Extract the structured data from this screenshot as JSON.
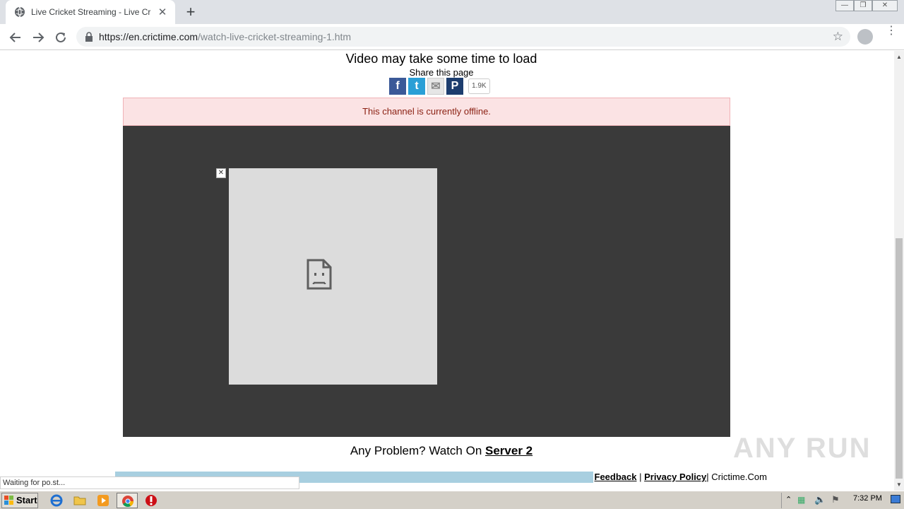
{
  "browser": {
    "tab_title": "Live Cricket Streaming - Live Cricket",
    "tab_close": "✕",
    "new_tab": "+",
    "url_domain": "https://en.crictime.com",
    "url_path": "/watch-live-cricket-streaming-1.htm",
    "win_minimize": "—",
    "win_restore": "❐",
    "win_close": "✕"
  },
  "page": {
    "heading": "Video may take some time to load",
    "share_label": "Share this page",
    "share_buttons": [
      {
        "name": "facebook",
        "glyph": "f",
        "color": "#3b5998"
      },
      {
        "name": "twitter",
        "glyph": "t",
        "color": "#2a9fd6"
      },
      {
        "name": "email",
        "glyph": "✉",
        "color": "#e6e6e6"
      },
      {
        "name": "pinterest",
        "glyph": "P",
        "color": "#1d3d6e"
      }
    ],
    "share_count": "1.9K",
    "offline_message": "This channel is currently offline.",
    "ad_close": "✕",
    "problem_text": "Any Problem? Watch On ",
    "server_link": "Server 2",
    "footer": {
      "feedback": "Feedback",
      "separator1": " | ",
      "privacy": "Privacy Policy",
      "separator2": "| ",
      "site": "Crictime.Com"
    }
  },
  "watermark": "ANY RUN",
  "status_text": "Waiting for po.st...",
  "taskbar": {
    "start_label": "Start",
    "clock": "7:32 PM"
  },
  "colors": {
    "offline_bg": "#fbe3e4",
    "player_bg": "#3a3a3a",
    "footer_bar": "#a8cfe0"
  }
}
